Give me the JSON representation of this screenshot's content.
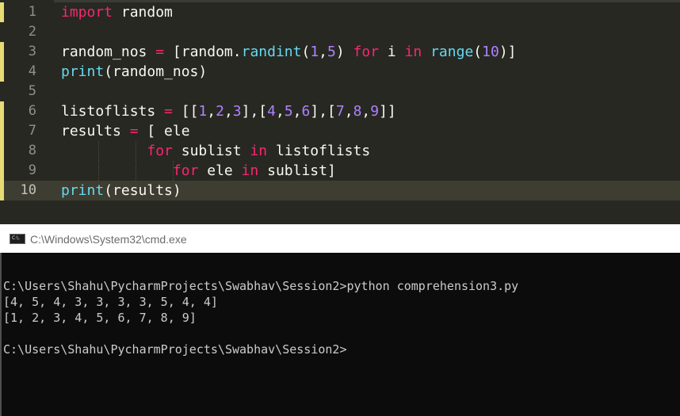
{
  "editor": {
    "lines": [
      {
        "number": "1",
        "tokens": [
          {
            "t": "import",
            "c": "kw"
          },
          {
            "t": " random",
            "c": "id"
          }
        ]
      },
      {
        "number": "2",
        "tokens": []
      },
      {
        "number": "3",
        "tokens": [
          {
            "t": "random_nos ",
            "c": "id"
          },
          {
            "t": "=",
            "c": "op"
          },
          {
            "t": " [random.",
            "c": "id"
          },
          {
            "t": "randint",
            "c": "fn"
          },
          {
            "t": "(",
            "c": "id"
          },
          {
            "t": "1",
            "c": "num"
          },
          {
            "t": ",",
            "c": "id"
          },
          {
            "t": "5",
            "c": "num"
          },
          {
            "t": ") ",
            "c": "id"
          },
          {
            "t": "for",
            "c": "kw"
          },
          {
            "t": " i ",
            "c": "id"
          },
          {
            "t": "in",
            "c": "kw"
          },
          {
            "t": " ",
            "c": "id"
          },
          {
            "t": "range",
            "c": "fn"
          },
          {
            "t": "(",
            "c": "id"
          },
          {
            "t": "10",
            "c": "num"
          },
          {
            "t": ")]",
            "c": "id"
          }
        ]
      },
      {
        "number": "4",
        "tokens": [
          {
            "t": "print",
            "c": "fn"
          },
          {
            "t": "(random_nos)",
            "c": "id"
          }
        ]
      },
      {
        "number": "5",
        "tokens": []
      },
      {
        "number": "6",
        "tokens": [
          {
            "t": "listoflists ",
            "c": "id"
          },
          {
            "t": "=",
            "c": "op"
          },
          {
            "t": " [[",
            "c": "id"
          },
          {
            "t": "1",
            "c": "num"
          },
          {
            "t": ",",
            "c": "id"
          },
          {
            "t": "2",
            "c": "num"
          },
          {
            "t": ",",
            "c": "id"
          },
          {
            "t": "3",
            "c": "num"
          },
          {
            "t": "],[",
            "c": "id"
          },
          {
            "t": "4",
            "c": "num"
          },
          {
            "t": ",",
            "c": "id"
          },
          {
            "t": "5",
            "c": "num"
          },
          {
            "t": ",",
            "c": "id"
          },
          {
            "t": "6",
            "c": "num"
          },
          {
            "t": "],[",
            "c": "id"
          },
          {
            "t": "7",
            "c": "num"
          },
          {
            "t": ",",
            "c": "id"
          },
          {
            "t": "8",
            "c": "num"
          },
          {
            "t": ",",
            "c": "id"
          },
          {
            "t": "9",
            "c": "num"
          },
          {
            "t": "]]",
            "c": "id"
          }
        ]
      },
      {
        "number": "7",
        "tokens": [
          {
            "t": "results ",
            "c": "id"
          },
          {
            "t": "=",
            "c": "op"
          },
          {
            "t": " [ ele",
            "c": "id"
          }
        ]
      },
      {
        "number": "8",
        "tokens": [
          {
            "t": "          ",
            "c": "id"
          },
          {
            "t": "for",
            "c": "kw"
          },
          {
            "t": " sublist ",
            "c": "id"
          },
          {
            "t": "in",
            "c": "kw"
          },
          {
            "t": " listoflists",
            "c": "id"
          }
        ]
      },
      {
        "number": "9",
        "tokens": [
          {
            "t": "             ",
            "c": "id"
          },
          {
            "t": "for",
            "c": "kw"
          },
          {
            "t": " ele ",
            "c": "id"
          },
          {
            "t": "in",
            "c": "kw"
          },
          {
            "t": " sublist]",
            "c": "id"
          }
        ]
      },
      {
        "number": "10",
        "tokens": [
          {
            "t": "print",
            "c": "fn"
          },
          {
            "t": "(results)",
            "c": "id"
          }
        ]
      }
    ]
  },
  "cmd": {
    "title": "C:\\Windows\\System32\\cmd.exe",
    "icon_label": "C:\\.",
    "lines": [
      "",
      "C:\\Users\\Shahu\\PycharmProjects\\Swabhav\\Session2>python comprehension3.py",
      "[4, 5, 4, 3, 3, 3, 3, 5, 4, 4]",
      "[1, 2, 3, 4, 5, 6, 7, 8, 9]",
      "",
      "C:\\Users\\Shahu\\PycharmProjects\\Swabhav\\Session2>"
    ]
  }
}
